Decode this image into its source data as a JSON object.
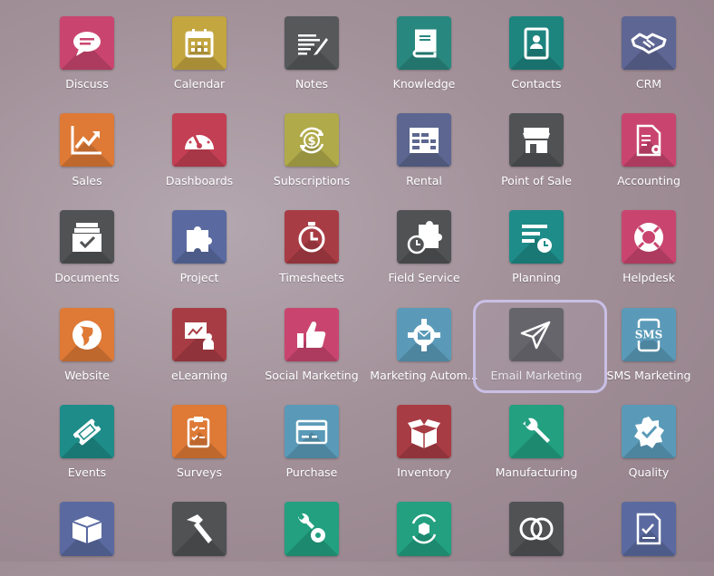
{
  "apps": [
    {
      "label": "Discuss",
      "color": "#c9456f",
      "icon": "chat-bubble-icon"
    },
    {
      "label": "Calendar",
      "color": "#c3a63f",
      "icon": "calendar-icon"
    },
    {
      "label": "Notes",
      "color": "#56585a",
      "icon": "notes-icon"
    },
    {
      "label": "Knowledge",
      "color": "#28877e",
      "icon": "book-icon"
    },
    {
      "label": "Contacts",
      "color": "#1d847e",
      "icon": "contact-book-icon"
    },
    {
      "label": "CRM",
      "color": "#5e6694",
      "icon": "handshake-icon"
    },
    {
      "label": "Sales",
      "color": "#de7a36",
      "icon": "chart-up-icon"
    },
    {
      "label": "Dashboards",
      "color": "#c33f53",
      "icon": "gauge-icon"
    },
    {
      "label": "Subscriptions",
      "color": "#b0aa4a",
      "icon": "dollar-cycle-icon"
    },
    {
      "label": "Rental",
      "color": "#5c6690",
      "icon": "calendar-grid-icon"
    },
    {
      "label": "Point of Sale",
      "color": "#505254",
      "icon": "shop-icon"
    },
    {
      "label": "Accounting",
      "color": "#c9456f",
      "icon": "invoice-gear-icon"
    },
    {
      "label": "Documents",
      "color": "#505254",
      "icon": "inbox-tray-icon"
    },
    {
      "label": "Project",
      "color": "#5a6aa0",
      "icon": "puzzle-icon"
    },
    {
      "label": "Timesheets",
      "color": "#a83c44",
      "icon": "stopwatch-icon"
    },
    {
      "label": "Field Service",
      "color": "#505254",
      "icon": "puzzle-clock-icon"
    },
    {
      "label": "Planning",
      "color": "#1e8c88",
      "icon": "list-clock-icon"
    },
    {
      "label": "Helpdesk",
      "color": "#c9456f",
      "icon": "lifebuoy-icon"
    },
    {
      "label": "Website",
      "color": "#de7a36",
      "icon": "globe-icon"
    },
    {
      "label": "eLearning",
      "color": "#a83c44",
      "icon": "presenter-icon"
    },
    {
      "label": "Social Marketing",
      "color": "#c9456f",
      "icon": "thumbs-up-icon"
    },
    {
      "label": "Marketing Autom...",
      "color": "#5a9ab8",
      "icon": "gear-mail-icon"
    },
    {
      "label": "Email Marketing",
      "color": "#505254",
      "icon": "paper-plane-icon"
    },
    {
      "label": "SMS Marketing",
      "color": "#5a9ab8",
      "icon": "sms-phone-icon",
      "sms": "SMS"
    },
    {
      "label": "Events",
      "color": "#1e8c88",
      "icon": "ticket-icon"
    },
    {
      "label": "Surveys",
      "color": "#de7a36",
      "icon": "clipboard-check-icon"
    },
    {
      "label": "Purchase",
      "color": "#5a9ab8",
      "icon": "credit-card-icon"
    },
    {
      "label": "Inventory",
      "color": "#a83c44",
      "icon": "open-box-icon"
    },
    {
      "label": "Manufacturing",
      "color": "#22a080",
      "icon": "wrench-icon"
    },
    {
      "label": "Quality",
      "color": "#5a9ab8",
      "icon": "badge-check-icon"
    },
    {
      "label": "",
      "color": "#5a6aa0",
      "icon": "box-icon"
    },
    {
      "label": "",
      "color": "#505254",
      "icon": "hammer-icon"
    },
    {
      "label": "",
      "color": "#22a080",
      "icon": "wrench-gear-icon"
    },
    {
      "label": "",
      "color": "#22a080",
      "icon": "box-cycle-icon"
    },
    {
      "label": "",
      "color": "#505254",
      "icon": "overlap-circles-icon"
    },
    {
      "label": "",
      "color": "#5a6aa0",
      "icon": "signed-doc-icon"
    }
  ]
}
